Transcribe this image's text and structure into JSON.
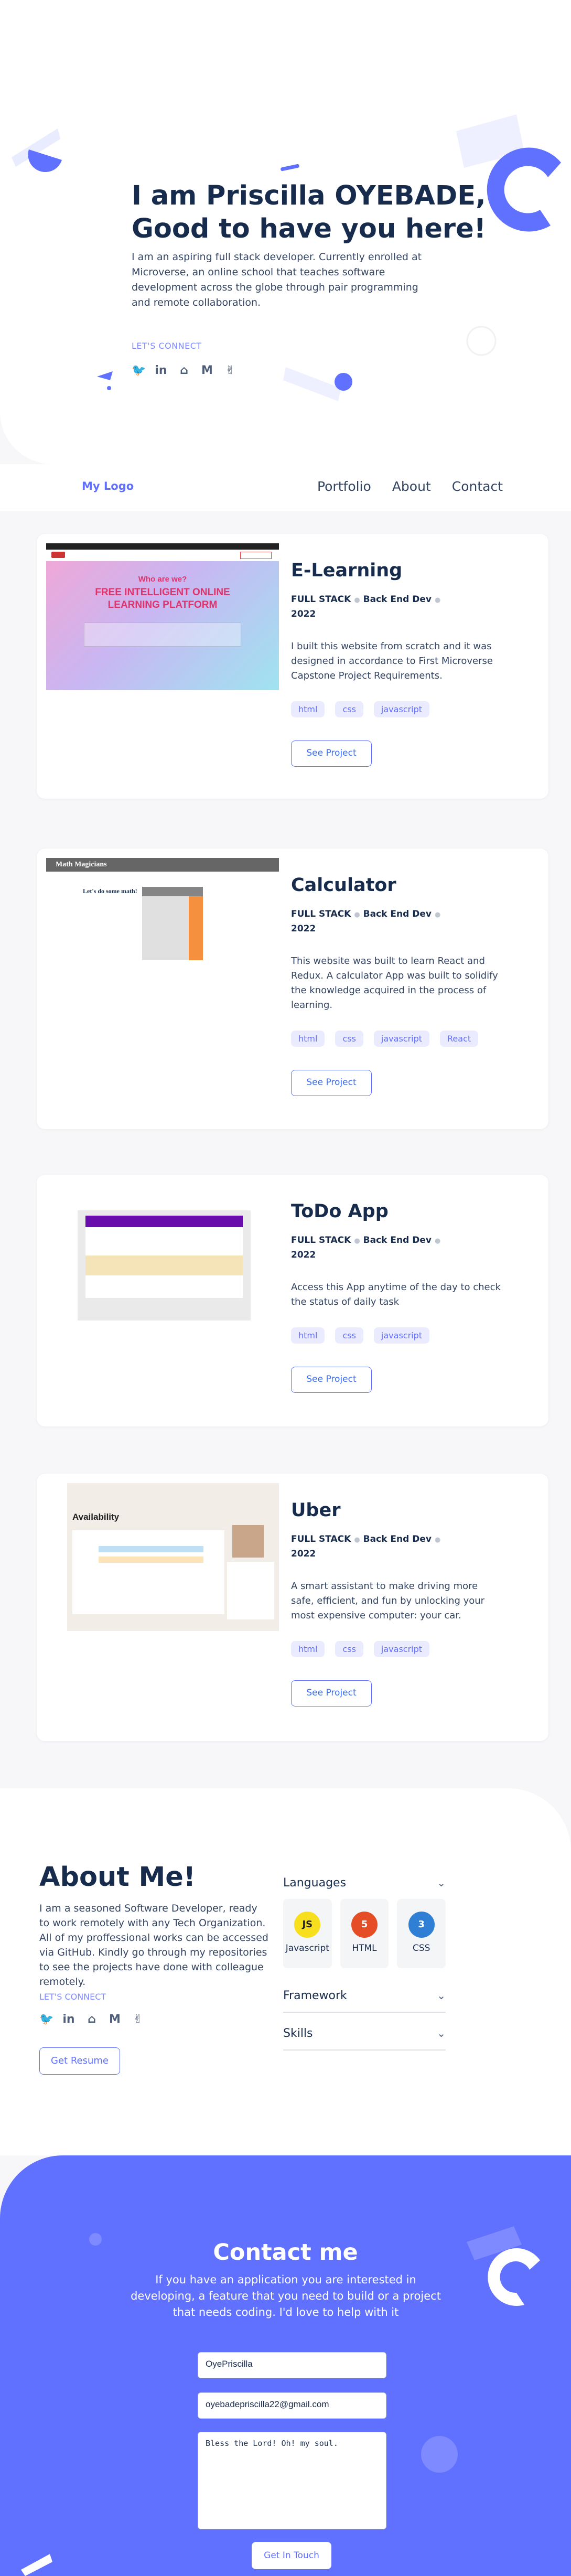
{
  "hero": {
    "title": "I am Priscilla OYEBADE, Good to have you here!",
    "intro": "I am an aspiring full stack developer. Currently enrolled at Microverse, an online school that teaches software development across the globe through pair programming and remote collaboration.",
    "connect_label": "LET'S CONNECT"
  },
  "social": {
    "icons": [
      "twitter-icon",
      "linkedin-icon",
      "github-icon",
      "medium-icon",
      "angellist-icon"
    ],
    "glyphs": [
      "🐦",
      "in",
      "⌂",
      "M",
      "✌"
    ]
  },
  "nav": {
    "logo": "My Logo",
    "links": [
      "Portfolio",
      "About",
      "Contact"
    ]
  },
  "projects": [
    {
      "title": "E-Learning",
      "stack": "FULL STACK",
      "role": "Back End Dev",
      "year": "2022",
      "description": "I built this website from scratch and it was designed in accordance to First Microverse Capstone Project Requirements.",
      "tags": [
        "html",
        "css",
        "javascript"
      ],
      "button": "See Project",
      "shot": {
        "headline_1": "Who are we?",
        "headline_2": "FREE INTELLIGENT ONLINE",
        "headline_3": "LEARNING PLATFORM"
      }
    },
    {
      "title": "Calculator",
      "stack": "FULL STACK",
      "role": "Back End Dev",
      "year": "2022",
      "description": "This website was built to learn React and Redux. A calculator App was built to solidify the knowledge acquired in the process of learning.",
      "tags": [
        "html",
        "css",
        "javascript",
        "React"
      ],
      "button": "See Project",
      "shot": {
        "brand": "Math Magicians",
        "prompt": "Let's do some math!"
      }
    },
    {
      "title": "ToDo App",
      "stack": "FULL STACK",
      "role": "Back End Dev",
      "year": "2022",
      "description": "Access this App anytime of the day to check the status of daily task",
      "tags": [
        "html",
        "css",
        "javascript"
      ],
      "button": "See Project"
    },
    {
      "title": "Uber",
      "stack": "FULL STACK",
      "role": "Back End Dev",
      "year": "2022",
      "description": "A smart assistant to make driving more safe, efficient, and fun by unlocking your most expensive computer: your car.",
      "tags": [
        "html",
        "css",
        "javascript"
      ],
      "button": "See Project",
      "shot": {
        "heading": "Availability"
      }
    }
  ],
  "about": {
    "title": "About Me!",
    "text": "I am a seasoned Software Developer, ready to work remotely with any Tech Organization. All of my proffessional works can be accessed via GitHub. Kindly go through my repositories to see the projects have done with colleague remotely.",
    "connect_label": "LET'S CONNECT",
    "resume_button": "Get Resume",
    "sections": {
      "languages": "Languages",
      "framework": "Framework",
      "skills": "Skills"
    },
    "languages": [
      {
        "name": "Javascript",
        "icon": "javascript-icon",
        "badge": "JS",
        "color": "#f7df1e",
        "text_color": "#222222"
      },
      {
        "name": "HTML",
        "icon": "html5-icon",
        "badge": "5",
        "color": "#e44d26",
        "text_color": "#ffffff"
      },
      {
        "name": "CSS",
        "icon": "css3-icon",
        "badge": "3",
        "color": "#2f7fd5",
        "text_color": "#ffffff"
      }
    ]
  },
  "contact": {
    "title": "Contact me",
    "subtitle": "If you have an application you are interested in developing, a feature that you need to build or a project that needs coding. I'd love to help with it",
    "name_value": "OyePriscilla",
    "email_value": "oyebadepriscilla22@gmail.com",
    "message_value": "Bless the Lord! Oh! my soul.",
    "button": "Get In Touch"
  },
  "colors": {
    "accent": "#6070ff",
    "heading": "#172b4d",
    "background": "#f7f7f9"
  }
}
